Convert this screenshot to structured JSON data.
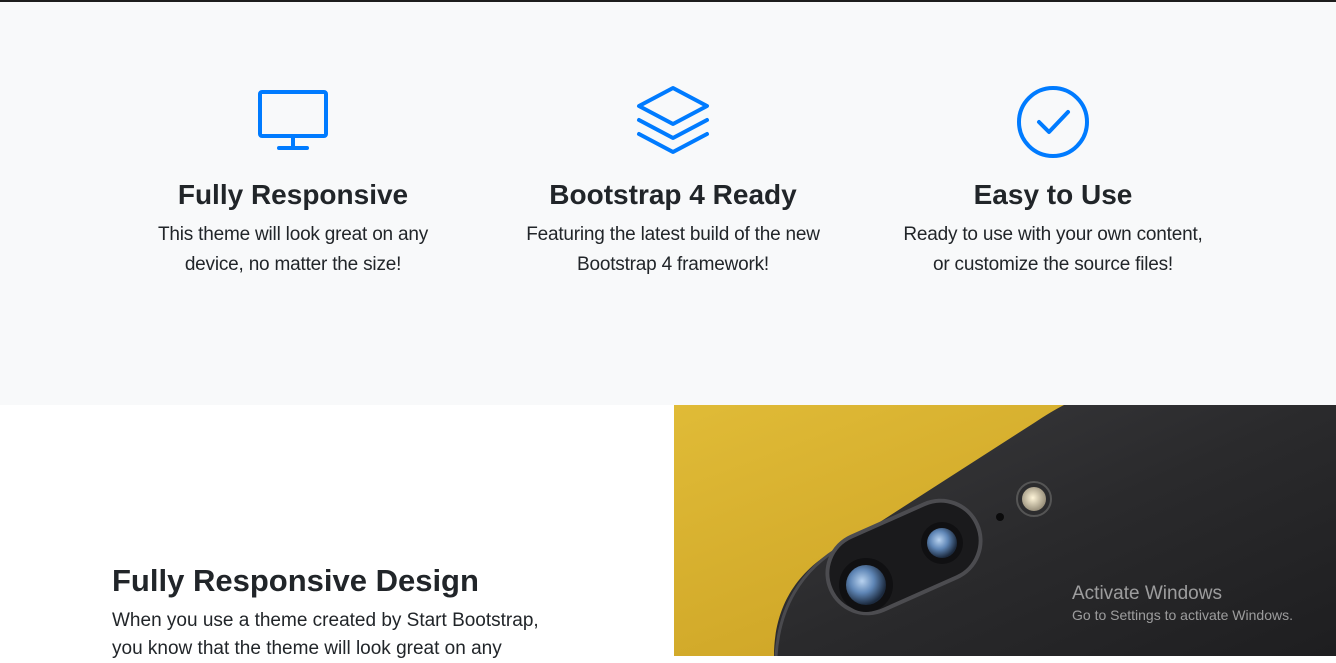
{
  "features": [
    {
      "icon": "desktop-icon",
      "title": "Fully Responsive",
      "line1": "This theme will look great on any",
      "line2": "device, no matter the size!"
    },
    {
      "icon": "layers-icon",
      "title": "Bootstrap 4 Ready",
      "line1": "Featuring the latest build of the new",
      "line2": "Bootstrap 4 framework!"
    },
    {
      "icon": "check-circle-icon",
      "title": "Easy to Use",
      "line1": "Ready to use with your own content,",
      "line2": "or customize the source files!"
    }
  ],
  "showcase": {
    "title": "Fully Responsive Design",
    "line1": "When you use a theme created by Start Bootstrap,",
    "line2": "you know that the theme will look great on any"
  },
  "watermark": {
    "title": "Activate Windows",
    "subtitle": "Go to Settings to activate Windows."
  },
  "colors": {
    "accent": "#007bff",
    "section_bg": "#f8f9fa",
    "text": "#212529"
  }
}
